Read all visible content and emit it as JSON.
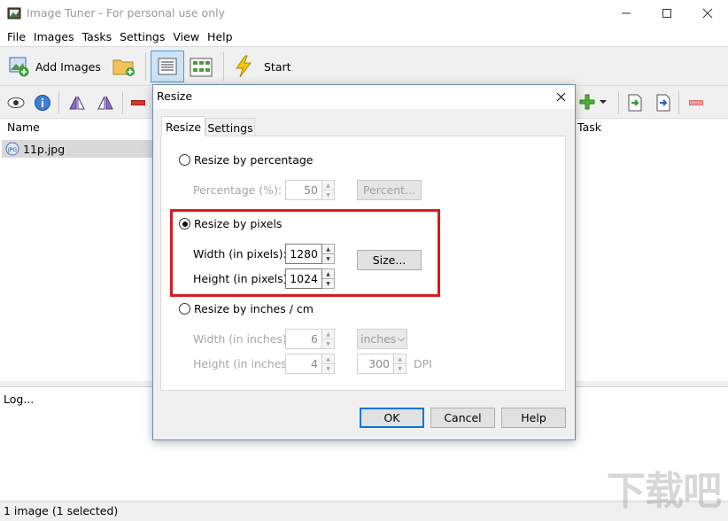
{
  "app": {
    "title": "Image Tuner - For personal use only"
  },
  "menu": [
    "File",
    "Images",
    "Tasks",
    "Settings",
    "View",
    "Help"
  ],
  "toolbar": {
    "add_images_label": "Add Images",
    "start_label": "Start"
  },
  "list": {
    "col_name": "Name",
    "col_task": "Task",
    "files": [
      {
        "name": "11p.jpg"
      }
    ]
  },
  "log": {
    "text": "Log..."
  },
  "status": {
    "text": "1 image (1 selected)"
  },
  "dialog": {
    "title": "Resize",
    "tabs": [
      "Resize",
      "Settings"
    ],
    "percentage": {
      "radio_label": "Resize by percentage",
      "field_label": "Percentage (%):",
      "value": "50",
      "button": "Percent..."
    },
    "pixels": {
      "radio_label": "Resize by pixels",
      "width_label": "Width (in pixels):",
      "width_value": "1280",
      "height_label": "Height (in pixels):",
      "height_value": "1024",
      "button": "Size..."
    },
    "inches": {
      "radio_label": "Resize by inches / cm",
      "width_label": "Width (in inches):",
      "width_value": "6",
      "height_label": "Height (in inches):",
      "height_value": "4",
      "unit": "inches",
      "dpi_value": "300",
      "dpi_label": "DPI"
    },
    "buttons": {
      "ok": "OK",
      "cancel": "Cancel",
      "help": "Help"
    }
  },
  "colors": {
    "highlight": "#d41c1c",
    "accent": "#0078d7"
  },
  "watermark": "下载吧"
}
